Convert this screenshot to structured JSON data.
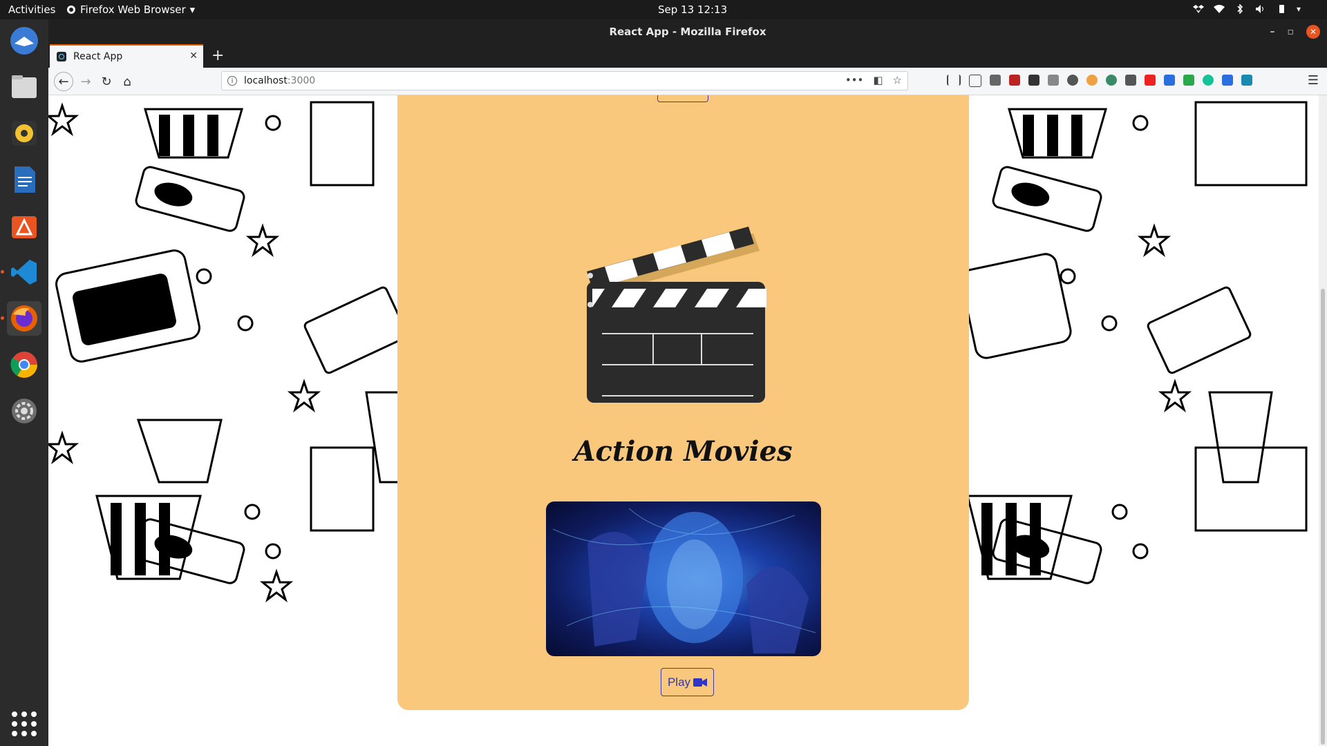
{
  "topbar": {
    "activities": "Activities",
    "app_name": "Firefox Web Browser",
    "datetime": "Sep 13  12:13"
  },
  "dock": {
    "items": [
      "thunderbird-icon",
      "files-icon",
      "rhythmbox-icon",
      "writer-icon",
      "software-icon",
      "vscode-icon",
      "firefox-icon",
      "chrome-icon",
      "settings-icon"
    ]
  },
  "window": {
    "title": "React App - Mozilla Firefox",
    "tab_title": "React App",
    "url_host": "localhost",
    "url_port": ":3000"
  },
  "page": {
    "section_title": "Action Movies",
    "play_label": "Play"
  },
  "colors": {
    "card_bg": "#f9c87c",
    "button_border": "#3b3baa",
    "dock_bg": "#2b2b2b",
    "accent": "#e95420"
  }
}
